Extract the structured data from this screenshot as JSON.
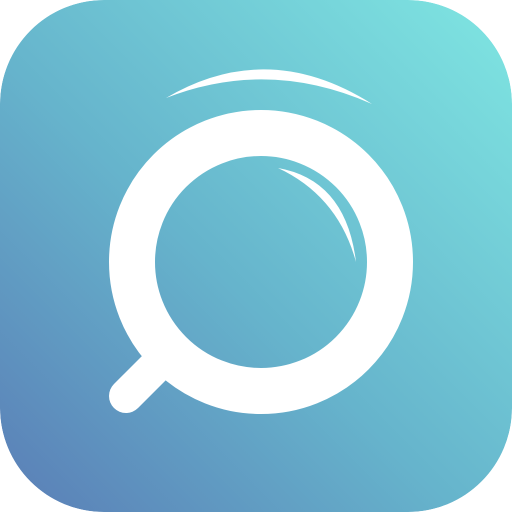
{
  "app_icon": {
    "icon": "magnifying-glass-icon",
    "colors": {
      "gradient_start": "#7FE6E2",
      "gradient_mid": "#66B4CC",
      "gradient_end": "#5A7DB6",
      "glyph": "#FFFFFF"
    }
  }
}
